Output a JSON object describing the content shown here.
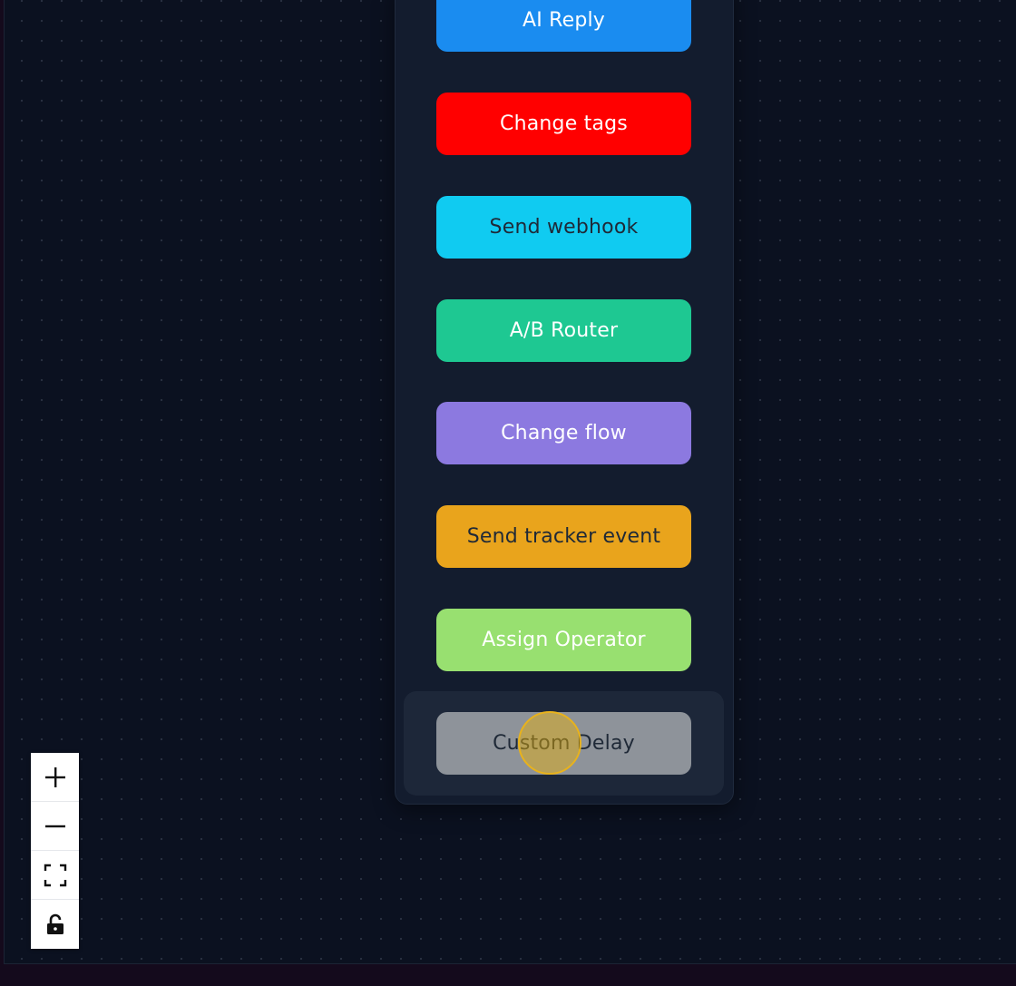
{
  "flow_canvas": {
    "palette": {
      "nodes": [
        {
          "label": "AI Reply",
          "bg": "#1a8cf0",
          "fg": "#ffffff",
          "icon": "none"
        },
        {
          "label": "Change tags",
          "bg": "#ff0000",
          "fg": "#ffffff",
          "icon": "none"
        },
        {
          "label": "Send webhook",
          "bg": "#10cbf1",
          "fg": "#1f2937",
          "icon": "none"
        },
        {
          "label": "A/B Router",
          "bg": "#1ec892",
          "fg": "#ffffff",
          "icon": "none"
        },
        {
          "label": "Change flow",
          "bg": "#8c79e0",
          "fg": "#ffffff",
          "icon": "none"
        },
        {
          "label": "Send tracker event",
          "bg": "#e9a41c",
          "fg": "#1f2937",
          "icon": "none"
        },
        {
          "label": "Assign Operator",
          "bg": "#98e070",
          "fg": "#ffffff",
          "icon": "none"
        },
        {
          "label": "Custom Delay",
          "bg": "#8e939a",
          "fg": "#1f2937",
          "icon": "none",
          "hovered": true
        }
      ]
    },
    "zoom_controls": {
      "zoom_in_icon": "plus-icon",
      "zoom_out_icon": "minus-icon",
      "fit_view_icon": "fullscreen-icon",
      "lock_icon": "unlocked-icon"
    }
  }
}
